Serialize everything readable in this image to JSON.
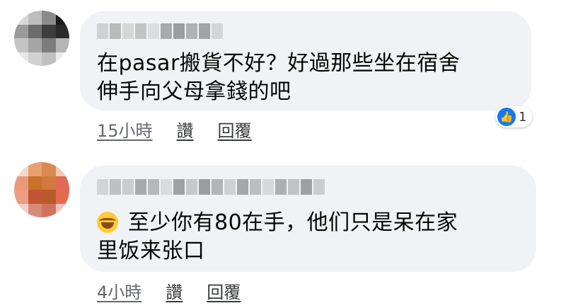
{
  "comments": [
    {
      "text_lines": [
        "在pasar搬貨不好？好過那些坐在宿舍",
        "伸手向父母拿錢的吧"
      ],
      "time": "15小時",
      "like_label": "讚",
      "reply_label": "回覆",
      "reaction_count": "1",
      "reaction_icon": "thumbs-up-icon"
    },
    {
      "emoji": "tears-of-joy-emoji",
      "text_lines": [
        "至少你有80在手，他们只是呆在家",
        "里饭来张口"
      ],
      "time": "4小時",
      "like_label": "讚",
      "reply_label": "回覆"
    }
  ],
  "colors": {
    "bubble": "#f0f2f5",
    "meta_text": "#65676b",
    "like_blue": "#1877f2"
  }
}
